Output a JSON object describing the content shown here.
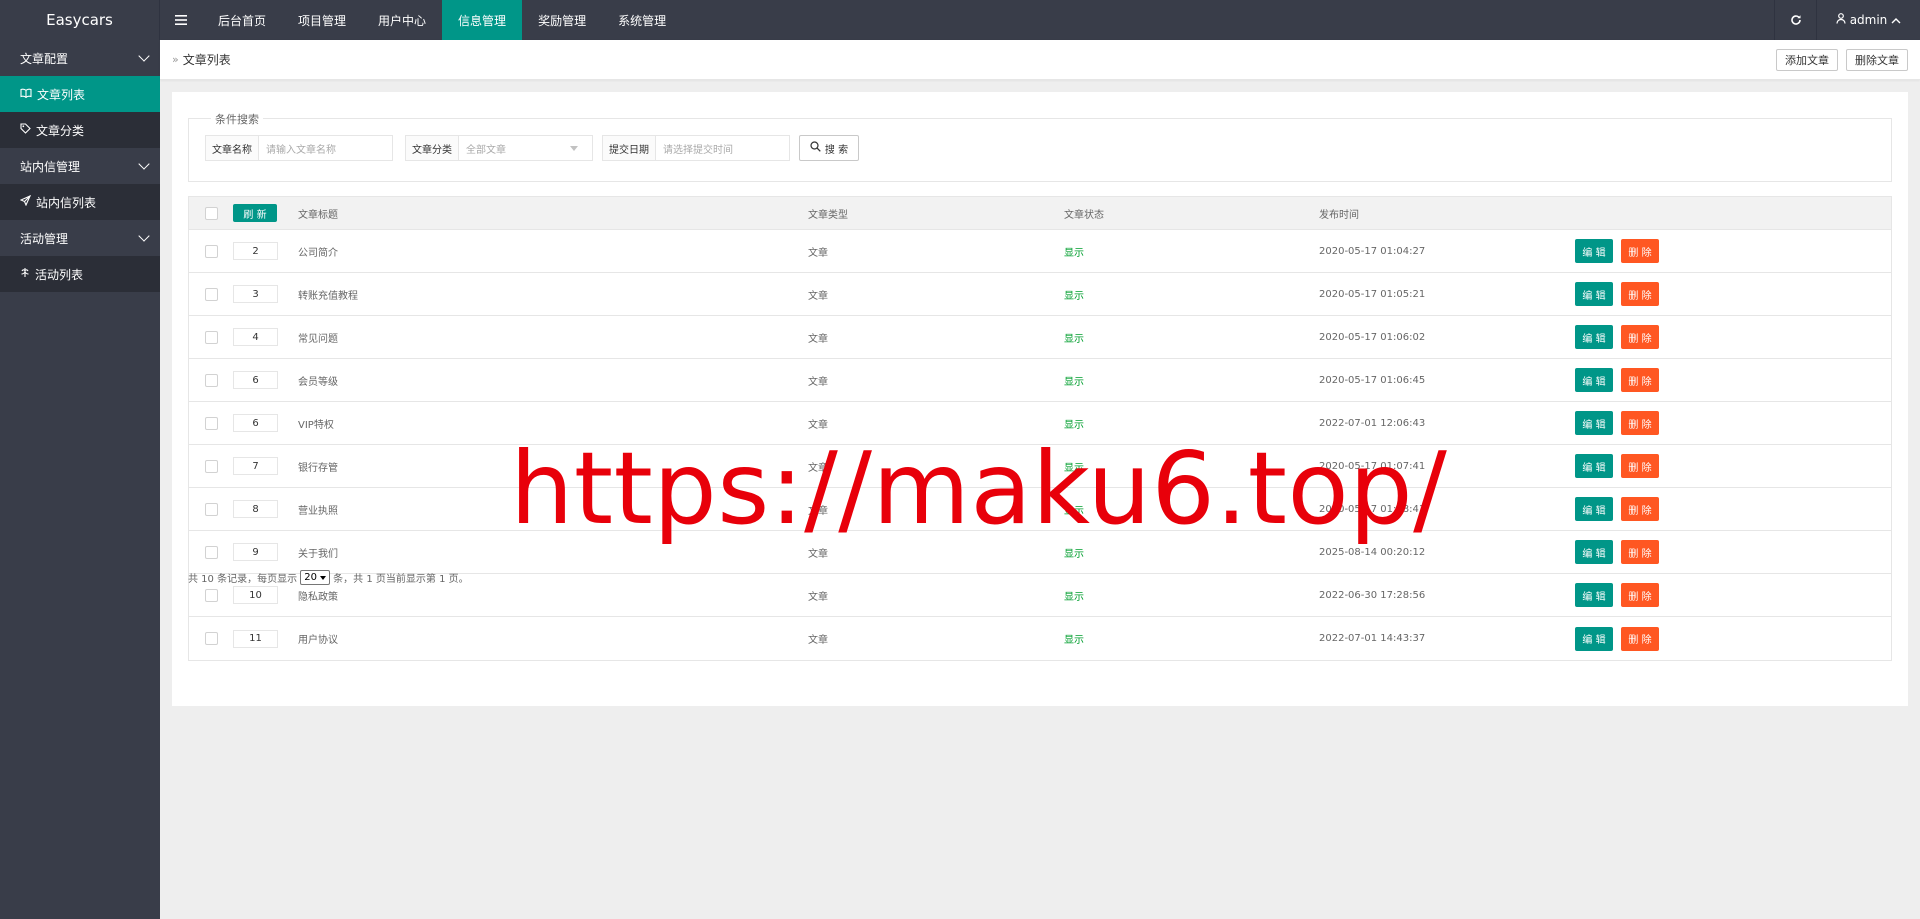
{
  "app": {
    "title": "Easycars"
  },
  "topnav": {
    "toggle_icon": "hamburger-icon",
    "items": [
      {
        "label": "后台首页"
      },
      {
        "label": "项目管理"
      },
      {
        "label": "用户中心"
      },
      {
        "label": "信息管理",
        "active": true
      },
      {
        "label": "奖励管理"
      },
      {
        "label": "系统管理"
      }
    ],
    "user": "admin"
  },
  "sidebar": {
    "groups": [
      {
        "label": "文章配置",
        "items": [
          {
            "label": "文章列表",
            "icon": "book-icon",
            "active": true
          },
          {
            "label": "文章分类",
            "icon": "tag-icon"
          }
        ]
      },
      {
        "label": "站内信管理",
        "items": [
          {
            "label": "站内信列表",
            "icon": "paper-plane-icon"
          }
        ]
      },
      {
        "label": "活动管理",
        "items": [
          {
            "label": "活动列表",
            "icon": "gift-icon"
          }
        ]
      }
    ]
  },
  "breadcrumb": {
    "current": "文章列表",
    "add_label": "添加文章",
    "delete_label": "删除文章"
  },
  "search": {
    "legend": "条件搜索",
    "name_label": "文章名称",
    "name_placeholder": "请输入文章名称",
    "category_label": "文章分类",
    "category_value": "全部文章",
    "date_label": "提交日期",
    "date_placeholder": "请选择提交时间",
    "button_label": "搜 索"
  },
  "table": {
    "refresh_label": "刷 新",
    "headers": {
      "title": "文章标题",
      "type": "文章类型",
      "status": "文章状态",
      "time": "发布时间"
    },
    "edit_label": "编 辑",
    "delete_label": "删 除",
    "rows": [
      {
        "sort": "2",
        "title": "公司简介",
        "type": "文章",
        "status": "显示",
        "time": "2020-05-17 01:04:27"
      },
      {
        "sort": "3",
        "title": "转账充值教程",
        "type": "文章",
        "status": "显示",
        "time": "2020-05-17 01:05:21"
      },
      {
        "sort": "4",
        "title": "常见问题",
        "type": "文章",
        "status": "显示",
        "time": "2020-05-17 01:06:02"
      },
      {
        "sort": "6",
        "title": "会员等级",
        "type": "文章",
        "status": "显示",
        "time": "2020-05-17 01:06:45"
      },
      {
        "sort": "6",
        "title": "VIP特权",
        "type": "文章",
        "status": "显示",
        "time": "2022-07-01 12:06:43"
      },
      {
        "sort": "7",
        "title": "银行存管",
        "type": "文章",
        "status": "显示",
        "time": "2020-05-17 01:07:41"
      },
      {
        "sort": "8",
        "title": "营业执照",
        "type": "文章",
        "status": "显示",
        "time": "2020-05-17 01:08:41"
      },
      {
        "sort": "9",
        "title": "关于我们",
        "type": "文章",
        "status": "显示",
        "time": "2025-08-14 00:20:12"
      },
      {
        "sort": "10",
        "title": "隐私政策",
        "type": "文章",
        "status": "显示",
        "time": "2022-06-30 17:28:56"
      },
      {
        "sort": "11",
        "title": "用户协议",
        "type": "文章",
        "status": "显示",
        "time": "2022-07-01 14:43:37"
      }
    ]
  },
  "pager": {
    "prefix": "共 10 条记录，每页显示 ",
    "page_size": "20",
    "suffix": " 条，共 1 页当前显示第 1 页。"
  },
  "watermark": "https://maku6.top/",
  "colors": {
    "accent": "#009688",
    "danger": "#ff5722",
    "topbar": "#393d49",
    "status_ok": "#009e2e",
    "watermark": "#e8000a"
  }
}
